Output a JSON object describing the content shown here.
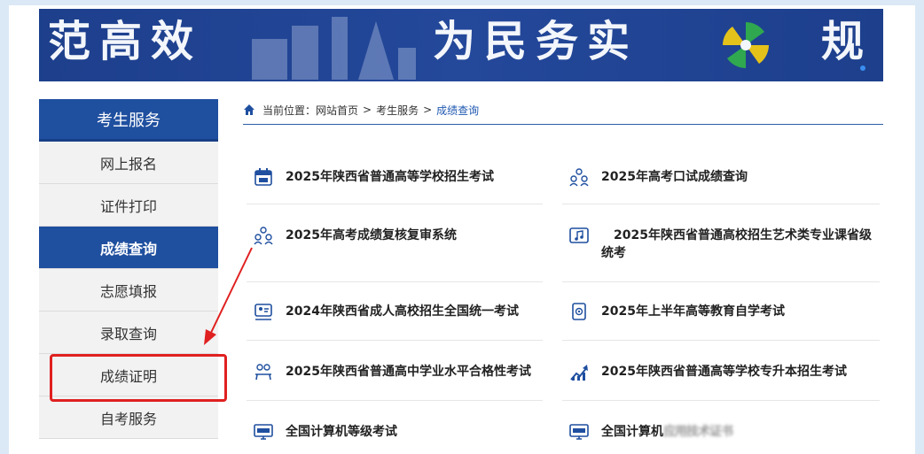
{
  "banner": {
    "left_text": "范高效",
    "right_text": "为民务实",
    "far_right_text": "规"
  },
  "sidebar": {
    "title": "考生服务",
    "items": [
      {
        "label": "网上报名"
      },
      {
        "label": "证件打印"
      },
      {
        "label": "成绩查询"
      },
      {
        "label": "志愿填报"
      },
      {
        "label": "录取查询"
      },
      {
        "label": "成绩证明"
      },
      {
        "label": "自考服务"
      }
    ]
  },
  "breadcrumb": {
    "prefix": "当前位置：",
    "home": "网站首页",
    "sep": ">",
    "section": "考生服务",
    "current": "成绩查询"
  },
  "services": [
    {
      "label": "2025年陕西省普通高等学校招生考试",
      "icon": "calendar-icon"
    },
    {
      "label": "2025年高考口试成绩查询",
      "icon": "people-icon"
    },
    {
      "label": "2025年高考成绩复核复审系统",
      "icon": "people-icon"
    },
    {
      "label": "2025年陕西省普通高校招生艺术类专业课省级统考",
      "icon": "music-icon"
    },
    {
      "label": "2024年陕西省成人高校招生全国统一考试",
      "icon": "id-card-icon"
    },
    {
      "label": "2025年上半年高等教育自学考试",
      "icon": "document-icon"
    },
    {
      "label": "2025年陕西省普通高中学业水平合格性考试",
      "icon": "people-table-icon"
    },
    {
      "label": "2025年陕西省普通高等学校专升本招生考试",
      "icon": "chart-up-icon"
    },
    {
      "label": "全国计算机等级考试",
      "icon": "ncre-monitor-icon"
    },
    {
      "label": "全国计算机",
      "label_blurred": "应用技术证书",
      "icon": "nit-monitor-icon"
    }
  ],
  "colors": {
    "banner_blue": "#1d3f8c",
    "sidebar_blue": "#1f4f9f",
    "link_blue": "#1f58b0",
    "annotation_red": "#e02020"
  }
}
